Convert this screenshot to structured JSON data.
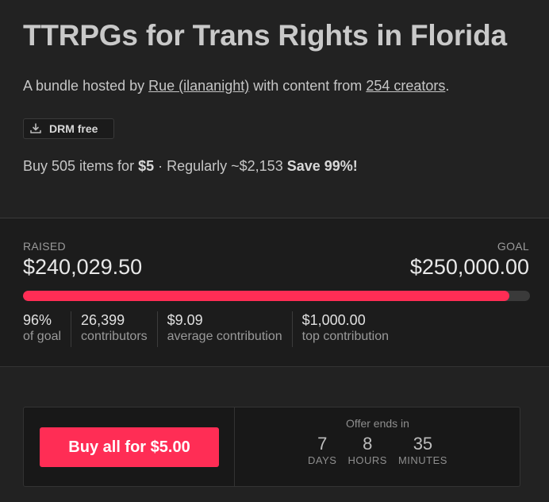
{
  "header": {
    "title": "TTRPGs for Trans Rights in Florida",
    "byline_prefix": "A bundle hosted by",
    "host_link": "Rue (ilananight)",
    "byline_middle": "with content from",
    "creators_link": "254 creators",
    "byline_suffix": ".",
    "drm_badge": "DRM free",
    "drm_icon": "download-icon"
  },
  "offer": {
    "prefix": "Buy 505 items for",
    "price": "$5",
    "regular": " · Regularly ~$2,153 ",
    "save": "Save 99%!"
  },
  "funding": {
    "raised_label": "RAISED",
    "raised_value": "$240,029.50",
    "goal_label": "GOAL",
    "goal_value": "$250,000.00",
    "progress_fraction": 0.96,
    "bar_color": "#ff2d55",
    "stats": [
      {
        "value": "96%",
        "label": "of goal"
      },
      {
        "value": "26,399",
        "label": "contributors"
      },
      {
        "value": "$9.09",
        "label": "average contribution"
      },
      {
        "value": "$1,000.00",
        "label": "top contribution"
      }
    ]
  },
  "purchase": {
    "button_label": "Buy all for $5.00",
    "button_color": "#ff2d55",
    "offer_ends_label": "Offer ends in",
    "countdown": [
      {
        "value": "7",
        "unit": "DAYS"
      },
      {
        "value": "8",
        "unit": "HOURS"
      },
      {
        "value": "35",
        "unit": "MINUTES"
      }
    ]
  }
}
